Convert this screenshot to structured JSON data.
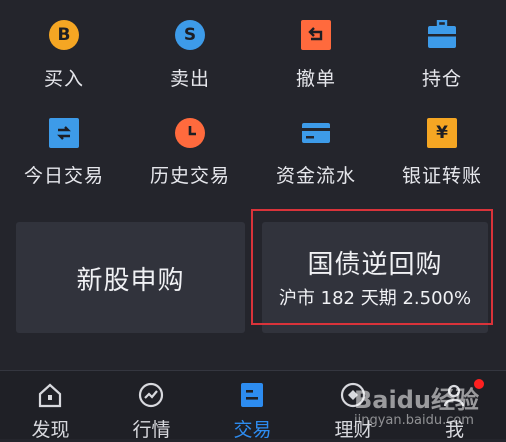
{
  "grid": {
    "buy": {
      "label": "买入",
      "icon": "buy-icon",
      "glyph": "B",
      "color": "#f5a623"
    },
    "sell": {
      "label": "卖出",
      "icon": "sell-icon",
      "glyph": "S",
      "color": "#3d9be9"
    },
    "cancel": {
      "label": "撤单",
      "icon": "cancel-order-icon",
      "color": "#ff6a3d"
    },
    "positions": {
      "label": "持仓",
      "icon": "briefcase-icon",
      "color": "#3d9be9"
    },
    "today_trades": {
      "label": "今日交易",
      "icon": "today-trades-icon",
      "color": "#3d9be9"
    },
    "history_trades": {
      "label": "历史交易",
      "icon": "clock-icon",
      "color": "#ff6a3d"
    },
    "fund_flow": {
      "label": "资金流水",
      "icon": "card-icon",
      "color": "#3d9be9"
    },
    "bank_transfer": {
      "label": "银证转账",
      "icon": "yuan-icon",
      "glyph": "¥",
      "color": "#f5a623"
    }
  },
  "cards": {
    "ipo": {
      "title": "新股申购"
    },
    "repo": {
      "title": "国债逆回购",
      "subtitle": "沪市 182 天期 2.500%"
    }
  },
  "tabs": [
    {
      "label": "发现",
      "icon": "home-icon"
    },
    {
      "label": "行情",
      "icon": "market-icon"
    },
    {
      "label": "交易",
      "icon": "trade-icon",
      "active": true
    },
    {
      "label": "理财",
      "icon": "finance-icon"
    },
    {
      "label": "我",
      "icon": "profile-icon",
      "badge": true
    }
  ],
  "watermark": {
    "brand": "Baidu经验",
    "url": "jingyan.baidu.com"
  },
  "colors": {
    "background": "#24252c",
    "accent": "#2d8cf0",
    "highlight": "#d9333a"
  }
}
